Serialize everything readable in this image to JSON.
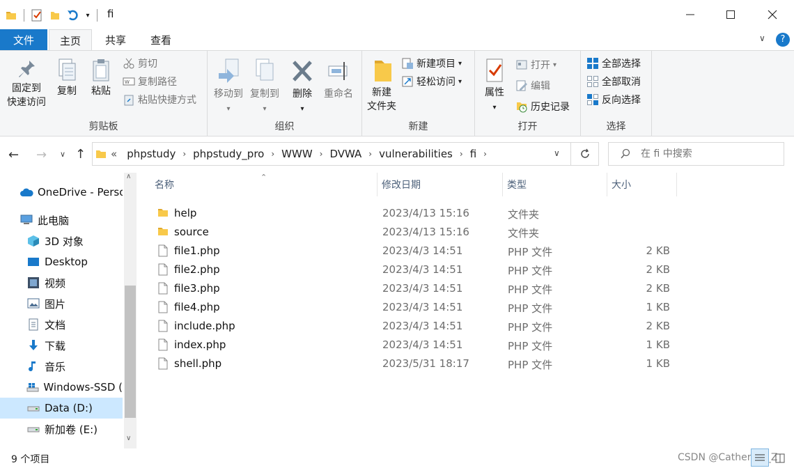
{
  "window": {
    "title": "fi"
  },
  "ribbon_tabs": {
    "file": "文件",
    "home": "主页",
    "share": "共享",
    "view": "查看"
  },
  "clipboard": {
    "pin_line1": "固定到",
    "pin_line2": "快速访问",
    "copy": "复制",
    "paste": "粘贴",
    "cut": "剪切",
    "copy_path": "复制路径",
    "paste_shortcut": "粘贴快捷方式",
    "label": "剪贴板"
  },
  "organize": {
    "move_to": "移动到",
    "copy_to": "复制到",
    "delete": "删除",
    "rename": "重命名",
    "label": "组织"
  },
  "new_group": {
    "new_folder_line1": "新建",
    "new_folder_line2": "文件夹",
    "new_item": "新建项目",
    "easy_access": "轻松访问",
    "label": "新建"
  },
  "open_group": {
    "properties": "属性",
    "open": "打开",
    "edit": "编辑",
    "history": "历史记录",
    "label": "打开"
  },
  "select_group": {
    "select_all": "全部选择",
    "select_none": "全部取消",
    "invert": "反向选择",
    "label": "选择"
  },
  "address": {
    "overflow": "«",
    "crumbs": [
      "phpstudy",
      "phpstudy_pro",
      "WWW",
      "DVWA",
      "vulnerabilities",
      "fi"
    ]
  },
  "search": {
    "placeholder": "在 fi 中搜索"
  },
  "nav": {
    "items": [
      {
        "label": "OneDrive - Perso",
        "icon": "onedrive-cloud-icon"
      },
      {
        "label": "此电脑",
        "icon": "this-pc-icon"
      },
      {
        "label": "3D 对象",
        "icon": "3d-objects-icon"
      },
      {
        "label": "Desktop",
        "icon": "desktop-icon"
      },
      {
        "label": "视频",
        "icon": "videos-icon"
      },
      {
        "label": "图片",
        "icon": "pictures-icon"
      },
      {
        "label": "文档",
        "icon": "documents-icon"
      },
      {
        "label": "下载",
        "icon": "downloads-icon"
      },
      {
        "label": "音乐",
        "icon": "music-icon"
      },
      {
        "label": "Windows-SSD (",
        "icon": "windows-drive-icon"
      },
      {
        "label": "Data (D:)",
        "icon": "drive-icon"
      },
      {
        "label": "新加卷 (E:)",
        "icon": "drive-icon"
      }
    ],
    "selected_index": 10
  },
  "columns": {
    "name": "名称",
    "date": "修改日期",
    "type": "类型",
    "size": "大小"
  },
  "files": [
    {
      "name": "help",
      "date": "2023/4/13 15:16",
      "type": "文件夹",
      "size": "",
      "kind": "folder"
    },
    {
      "name": "source",
      "date": "2023/4/13 15:16",
      "type": "文件夹",
      "size": "",
      "kind": "folder"
    },
    {
      "name": "file1.php",
      "date": "2023/4/3 14:51",
      "type": "PHP 文件",
      "size": "2 KB",
      "kind": "file"
    },
    {
      "name": "file2.php",
      "date": "2023/4/3 14:51",
      "type": "PHP 文件",
      "size": "2 KB",
      "kind": "file"
    },
    {
      "name": "file3.php",
      "date": "2023/4/3 14:51",
      "type": "PHP 文件",
      "size": "2 KB",
      "kind": "file"
    },
    {
      "name": "file4.php",
      "date": "2023/4/3 14:51",
      "type": "PHP 文件",
      "size": "1 KB",
      "kind": "file"
    },
    {
      "name": "include.php",
      "date": "2023/4/3 14:51",
      "type": "PHP 文件",
      "size": "2 KB",
      "kind": "file"
    },
    {
      "name": "index.php",
      "date": "2023/4/3 14:51",
      "type": "PHP 文件",
      "size": "1 KB",
      "kind": "file"
    },
    {
      "name": "shell.php",
      "date": "2023/5/31 18:17",
      "type": "PHP 文件",
      "size": "1 KB",
      "kind": "file"
    }
  ],
  "status": {
    "count": "9 个项目"
  },
  "watermark": "CSDN @Catherine_Z",
  "colors": {
    "accent": "#1979ca",
    "folder": "#f8c94a",
    "selected": "#cce8ff"
  }
}
